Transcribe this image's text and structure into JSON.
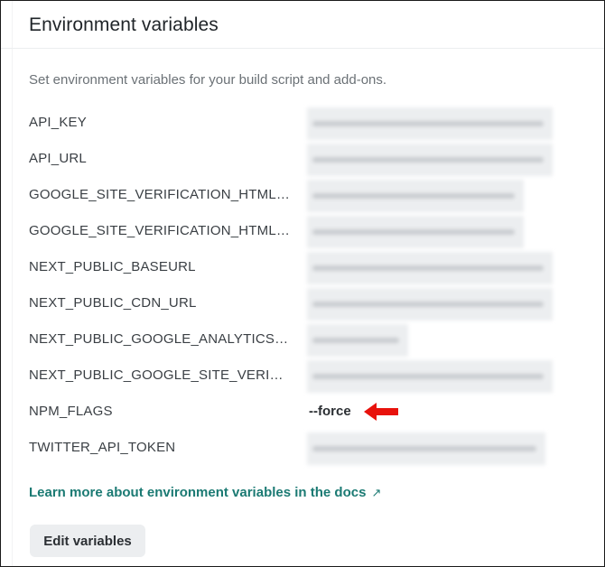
{
  "section": {
    "title": "Environment variables",
    "description": "Set environment variables for your build script and add-ons."
  },
  "variables": [
    {
      "key": "API_KEY",
      "value": "",
      "masked": true
    },
    {
      "key": "API_URL",
      "value": "",
      "masked": true
    },
    {
      "key": "GOOGLE_SITE_VERIFICATION_HTML_C...",
      "value": "",
      "masked": true
    },
    {
      "key": "GOOGLE_SITE_VERIFICATION_HTML_FI...",
      "value": "",
      "masked": true
    },
    {
      "key": "NEXT_PUBLIC_BASEURL",
      "value": "",
      "masked": true
    },
    {
      "key": "NEXT_PUBLIC_CDN_URL",
      "value": "",
      "masked": true
    },
    {
      "key": "NEXT_PUBLIC_GOOGLE_ANALYTICS_ID",
      "value": "",
      "masked": true
    },
    {
      "key": "NEXT_PUBLIC_GOOGLE_SITE_VERIFICA...",
      "value": "",
      "masked": true
    },
    {
      "key": "NPM_FLAGS",
      "value": "--force",
      "masked": false
    },
    {
      "key": "TWITTER_API_TOKEN",
      "value": "",
      "masked": true
    }
  ],
  "docs_link": {
    "label": "Learn more about environment variables in the docs",
    "icon": "external-link-icon"
  },
  "edit_button": {
    "label": "Edit variables"
  },
  "annotation": {
    "icon": "red-arrow-left-icon",
    "color": "#e8120c"
  }
}
